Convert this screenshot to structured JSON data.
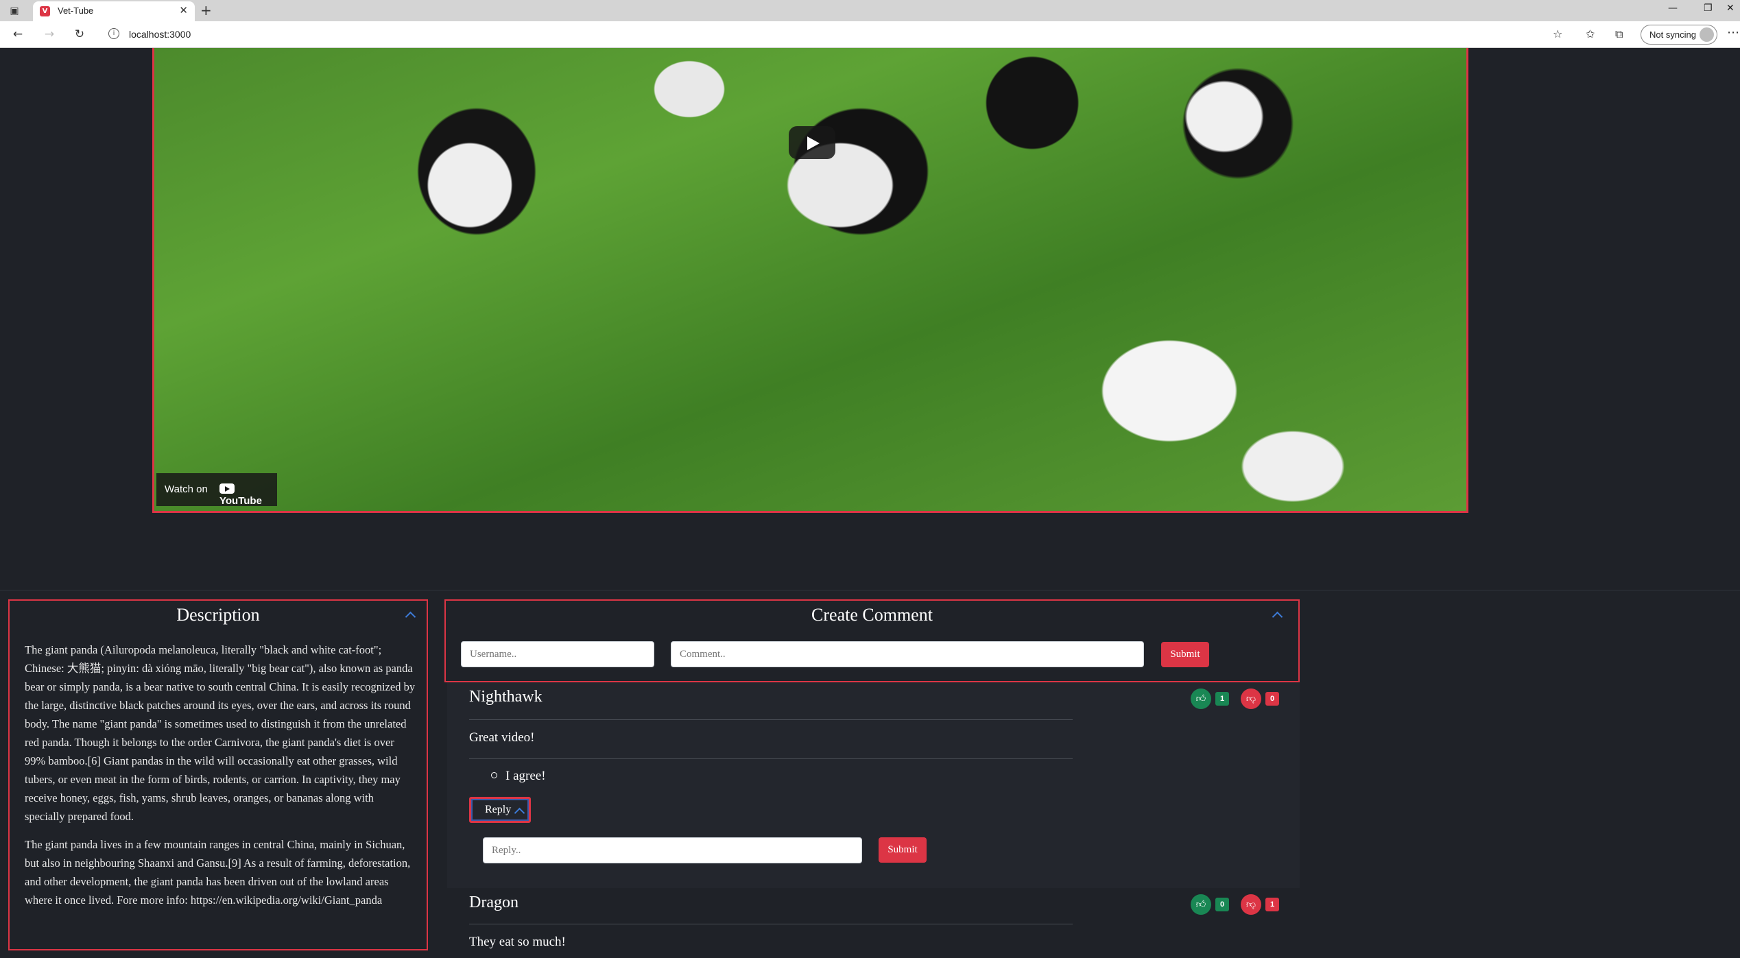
{
  "browser": {
    "tab_title": "Vet-Tube",
    "url": "localhost:3000",
    "sync_label": "Not syncing",
    "icons": {
      "tab_actions": "tab-actions-icon",
      "close": "close-icon",
      "new_tab": "plus-icon",
      "back": "back-arrow-icon",
      "forward": "forward-arrow-icon",
      "refresh": "refresh-icon",
      "info": "info-icon",
      "favorites_add": "star-plus-icon",
      "favorites": "favorites-icon",
      "collections": "collections-icon",
      "more": "more-icon"
    }
  },
  "video": {
    "watch_on_label": "Watch on",
    "youtube_label": "YouTube"
  },
  "description": {
    "title": "Description",
    "paragraphs": [
      "The giant panda (Ailuropoda melanoleuca, literally \"black and white cat-foot\"; Chinese: 大熊猫; pinyin: dà xióng māo, literally \"big bear cat\"), also known as panda bear or simply panda, is a bear native to south central China. It is easily recognized by the large, distinctive black patches around its eyes, over the ears, and across its round body. The name \"giant panda\" is sometimes used to distinguish it from the unrelated red panda. Though it belongs to the order Carnivora, the giant panda's diet is over 99% bamboo.[6] Giant pandas in the wild will occasionally eat other grasses, wild tubers, or even meat in the form of birds, rodents, or carrion. In captivity, they may receive honey, eggs, fish, yams, shrub leaves, oranges, or bananas along with specially prepared food.",
      "The giant panda lives in a few mountain ranges in central China, mainly in Sichuan, but also in neighbouring Shaanxi and Gansu.[9] As a result of farming, deforestation, and other development, the giant panda has been driven out of the lowland areas where it once lived. Fore more info: https://en.wikipedia.org/wiki/Giant_panda"
    ]
  },
  "create_comment": {
    "title": "Create Comment",
    "username_placeholder": "Username..",
    "comment_placeholder": "Comment..",
    "submit_label": "Submit"
  },
  "comments": [
    {
      "user": "Nighthawk",
      "text": "Great video!",
      "likes": "1",
      "dislikes": "0",
      "replies": [
        "I agree!"
      ],
      "reply_label": "Reply",
      "reply_placeholder": "Reply..",
      "reply_submit_label": "Submit"
    },
    {
      "user": "Dragon",
      "text": "They eat so much!",
      "likes": "0",
      "dislikes": "1"
    }
  ],
  "colors": {
    "accent": "#dc3545",
    "like": "#198754",
    "background": "#1f2228"
  }
}
